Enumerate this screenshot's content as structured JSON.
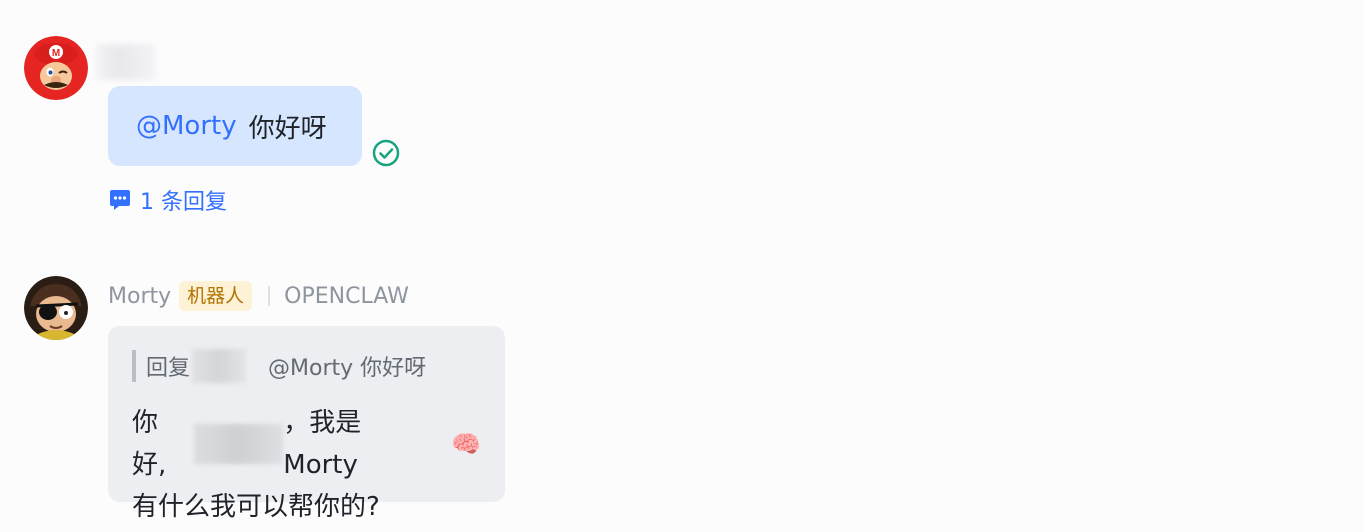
{
  "message_user": {
    "mention": "@Morty",
    "text": "你好呀",
    "reply_count_label": "1 条回复"
  },
  "message_bot": {
    "sender_name": "Morty",
    "bot_badge": "机器人",
    "app_label": "OPENCLAW",
    "quote_prefix": "回复",
    "quote_text": "@Morty 你好呀",
    "greeting_start": "你好,",
    "greeting_end": "，我是 Morty",
    "emoji": "🧠",
    "line2": "有什么我可以帮你的?"
  },
  "icons": {
    "sent_status": "check-circle-icon",
    "thread": "chat-bubble-icon"
  },
  "colors": {
    "accent": "#3370ff",
    "my_bubble": "#d6e6ff",
    "bot_bubble": "#eceef1",
    "badge_bg": "#fdf1d6",
    "badge_text": "#b27300",
    "check": "#19a27f"
  }
}
